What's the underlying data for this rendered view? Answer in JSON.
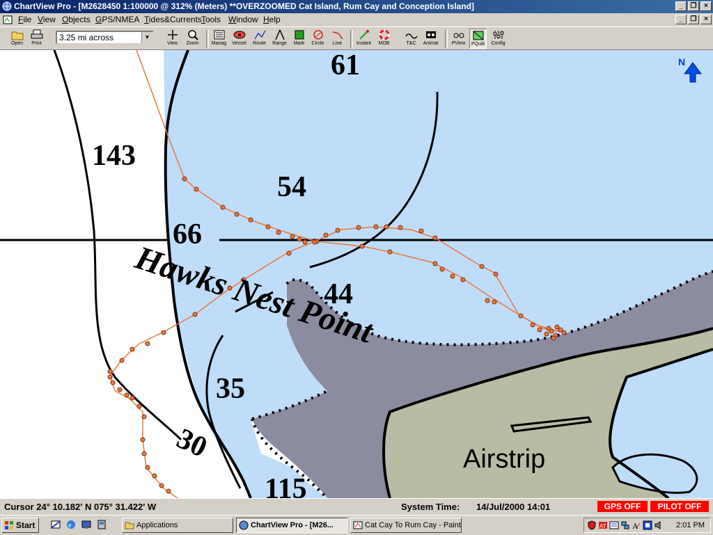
{
  "window": {
    "title": "ChartView Pro - [M2628450 1:100000 @ 312% (Meters) **OVERZOOMED Cat Island, Rum Cay and Conception Island]",
    "controls": [
      "_",
      "❐",
      "×"
    ]
  },
  "menu": [
    "File",
    "View",
    "Objects",
    "GPS/NMEA",
    "Tides&Currents",
    "Tools",
    "Window",
    "Help"
  ],
  "toolbar": {
    "scale": "3.25 mi across",
    "buttons": {
      "open": "Open",
      "print": "Print",
      "view": "View",
      "zoom": "Zoom",
      "manage": "Manag",
      "vessel": "Vessel",
      "route": "Route",
      "range": "Range",
      "mark": "Mark",
      "circle": "Circle",
      "line": "Line",
      "instant": "Instant",
      "mob": "MOB",
      "tc": "T&C",
      "animate": "Animat",
      "pview": "PView",
      "pquilt": "PQuilt",
      "config": "Config"
    }
  },
  "chart": {
    "depths": [
      "61",
      "143",
      "54",
      "66",
      "44",
      "35",
      "30",
      "115"
    ],
    "place_name": "Hawks Nest Point",
    "feature_label": "Airstrip",
    "north_label": "N",
    "colors": {
      "water": "#bfdcf8",
      "land": "#b8bca4",
      "drying": "#8c8ca0",
      "track": "#e87840"
    }
  },
  "status": {
    "cursor": "Cursor 24° 10.182' N  075° 31.422' W",
    "system_time_label": "System Time:",
    "system_time": "14/Jul/2000  14:01",
    "gps": "GPS OFF",
    "pilot": "PILOT OFF"
  },
  "taskbar": {
    "start": "Start",
    "tasks": [
      "Applications",
      "ChartView Pro - [M26...",
      "Cat Cay To Rum Cay - Paint"
    ],
    "clock": "2:01 PM"
  }
}
